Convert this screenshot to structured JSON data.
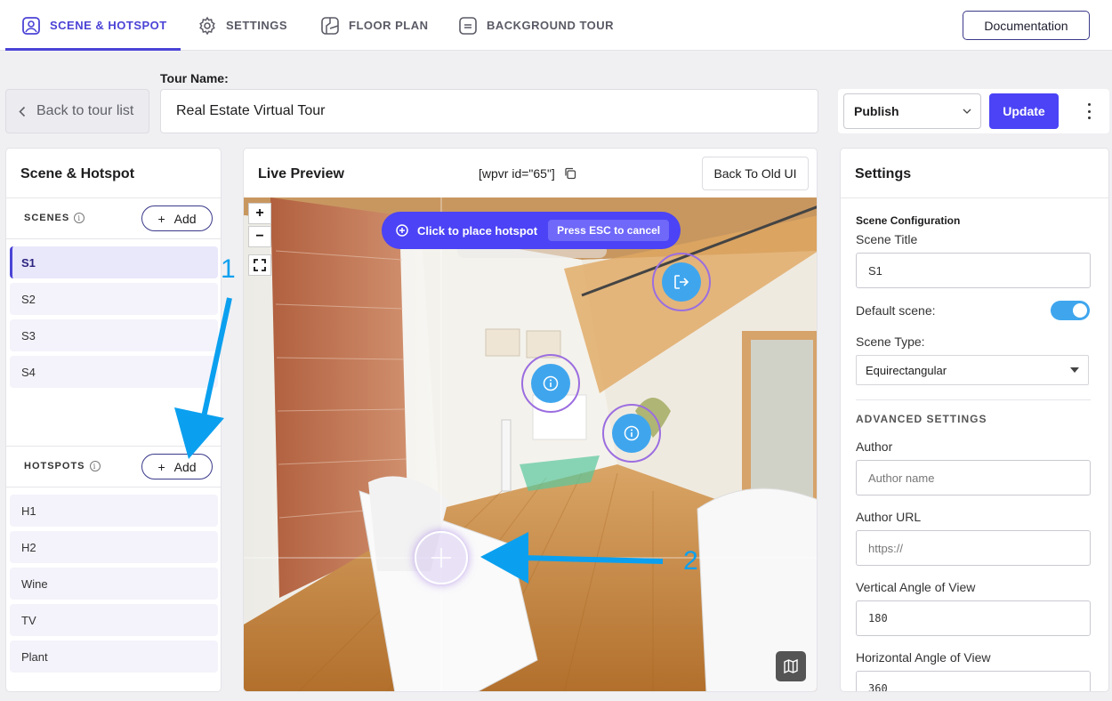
{
  "tabs": [
    {
      "label": "SCENE & HOTSPOT",
      "icon": "image-icon",
      "active": true
    },
    {
      "label": "SETTINGS",
      "icon": "gear-icon"
    },
    {
      "label": "FLOOR PLAN",
      "icon": "floor-plan-icon"
    },
    {
      "label": "BACKGROUND TOUR",
      "icon": "background-tour-icon"
    }
  ],
  "header": {
    "documentation_label": "Documentation"
  },
  "toolbar": {
    "back_label": "Back to tour list",
    "tour_name_label": "Tour Name:",
    "tour_name_value": "Real Estate Virtual Tour",
    "publish_value": "Publish",
    "update_label": "Update"
  },
  "left": {
    "title": "Scene & Hotspot",
    "scenes_label": "SCENES",
    "hotspots_label": "HOTSPOTS",
    "add_label": "Add",
    "scenes": [
      "S1",
      "S2",
      "S3",
      "S4"
    ],
    "hotspots": [
      "H1",
      "H2",
      "Wine",
      "TV",
      "Plant"
    ]
  },
  "preview": {
    "title": "Live Preview",
    "shortcode": "[wpvr id=\"65\"]",
    "old_ui_label": "Back To Old UI",
    "place_hotspot_label": "Click to place hotspot",
    "esc_label": "Press ESC to cancel"
  },
  "settings": {
    "title": "Settings",
    "scene_config_label": "Scene Configuration",
    "scene_title_label": "Scene Title",
    "scene_title_value": "S1",
    "default_scene_label": "Default scene:",
    "default_scene_on": true,
    "scene_type_label": "Scene Type:",
    "scene_type_value": "Equirectangular",
    "advanced_label": "ADVANCED SETTINGS",
    "author_label": "Author",
    "author_placeholder": "Author name",
    "author_url_label": "Author URL",
    "author_url_placeholder": "https://",
    "vaov_label": "Vertical Angle of View",
    "vaov_value": "180",
    "haov_label": "Horizontal Angle of View",
    "haov_value": "360"
  },
  "annotations": {
    "step1": "1",
    "step2": "2"
  },
  "colors": {
    "accent": "#4b43d6",
    "button": "#4b43f5",
    "hotspot": "#3fa6ee",
    "annotation": "#0ba0ef"
  }
}
